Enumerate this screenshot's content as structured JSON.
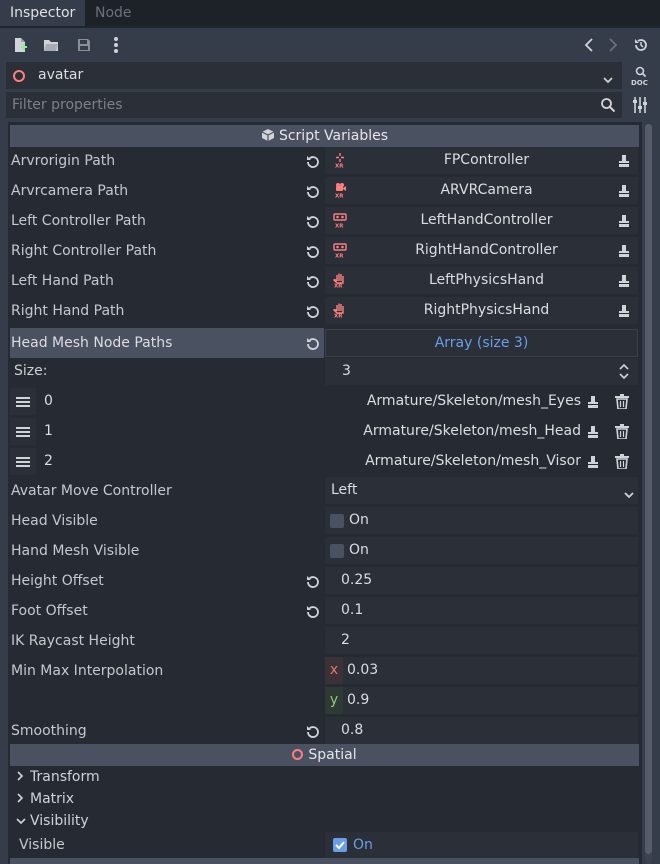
{
  "tabs": [
    {
      "label": "Inspector",
      "active": true
    },
    {
      "label": "Node",
      "active": false
    }
  ],
  "node_selector": {
    "name": "avatar"
  },
  "filter": {
    "placeholder": "Filter properties"
  },
  "sections": {
    "script_variables": "Script Variables",
    "spatial": "Spatial"
  },
  "node_paths": [
    {
      "label": "Arvrorigin Path",
      "value": "FPController"
    },
    {
      "label": "Arvrcamera Path",
      "value": "ARVRCamera"
    },
    {
      "label": "Left Controller Path",
      "value": "LeftHandController"
    },
    {
      "label": "Right Controller Path",
      "value": "RightHandController"
    },
    {
      "label": "Left Hand Path",
      "value": "LeftPhysicsHand"
    },
    {
      "label": "Right Hand Path",
      "value": "RightPhysicsHand"
    }
  ],
  "head_mesh": {
    "label": "Head Mesh Node Paths",
    "value": "Array (size 3)",
    "size_label": "Size:",
    "size_value": "3",
    "items": [
      {
        "index": "0",
        "value": "Armature/Skeleton/mesh_Eyes"
      },
      {
        "index": "1",
        "value": "Armature/Skeleton/mesh_Head"
      },
      {
        "index": "2",
        "value": "Armature/Skeleton/mesh_Visor"
      }
    ]
  },
  "avatar_move": {
    "label": "Avatar Move Controller",
    "value": "Left"
  },
  "head_visible": {
    "label": "Head Visible",
    "value": "On"
  },
  "hand_mesh_visible": {
    "label": "Hand Mesh Visible",
    "value": "On"
  },
  "height_offset": {
    "label": "Height Offset",
    "value": "0.25"
  },
  "foot_offset": {
    "label": "Foot Offset",
    "value": "0.1"
  },
  "ik_raycast": {
    "label": "IK Raycast Height",
    "value": "2"
  },
  "min_max": {
    "label": "Min Max Interpolation",
    "x_label": "x",
    "x": "0.03",
    "y_label": "y",
    "y": "0.9"
  },
  "smoothing": {
    "label": "Smoothing",
    "value": "0.8"
  },
  "spatial_tree": [
    {
      "label": "Transform"
    },
    {
      "label": "Matrix"
    },
    {
      "label": "Visibility"
    }
  ],
  "visible": {
    "label": "Visible",
    "value": "On"
  },
  "colors": {
    "accent": "#6a9fe8",
    "node_icon": "#fc7f7f",
    "array_link": "#6a9fe8"
  }
}
